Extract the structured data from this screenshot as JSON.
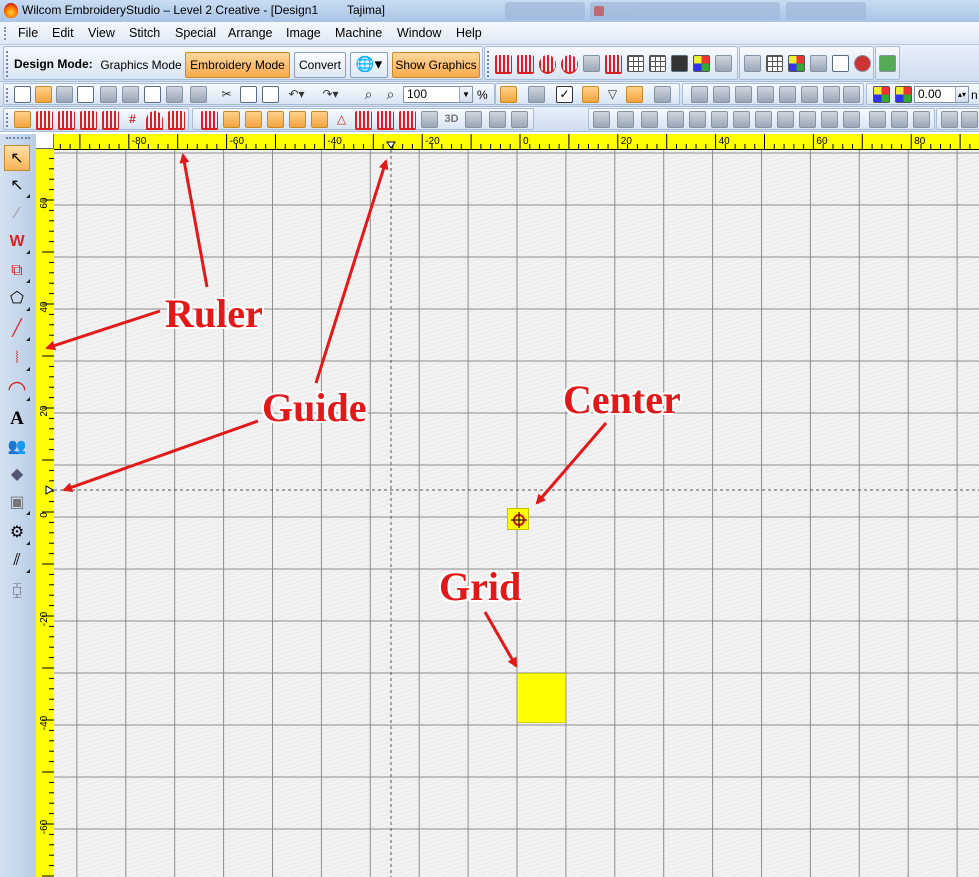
{
  "window": {
    "title": "Wilcom EmbroideryStudio – Level 2 Creative - [Design1",
    "machine": "Tajima]"
  },
  "menu": [
    "File",
    "Edit",
    "View",
    "Stitch",
    "Special",
    "Arrange",
    "Image",
    "Machine",
    "Window",
    "Help"
  ],
  "toolbar": {
    "design_mode_label": "Design Mode:",
    "graphics_mode": "Graphics Mode",
    "embroidery_mode": "Embroidery Mode",
    "convert": "Convert",
    "show_graphics": "Show Graphics",
    "zoom_value": "100",
    "zoom_unit": "%",
    "offset_value": "0.00",
    "offset_unit_partial": "n"
  },
  "rulers": {
    "top_labels": [
      "-80",
      "-60",
      "-40",
      "-20",
      "0",
      "20",
      "40",
      "60",
      "80"
    ],
    "left_labels": [
      "60",
      "40",
      "20",
      "0",
      "-20",
      "-40",
      "-60"
    ],
    "color": "#ffff00"
  },
  "annotations": {
    "ruler": "Ruler",
    "guide": "Guide",
    "center": "Center",
    "grid": "Grid",
    "color": "#e31818"
  }
}
